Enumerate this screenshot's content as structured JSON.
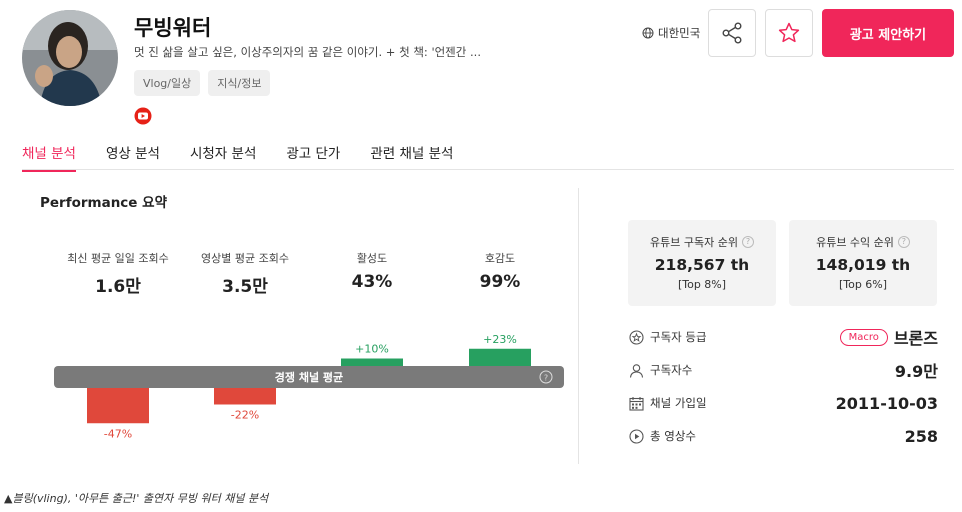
{
  "channel": {
    "name": "무빙워터",
    "description": "멋 진 삶을 살고 싶은, 이상주의자의 꿈 같은 이야기. + 첫 책: '언젠간 ...",
    "tags": [
      "Vlog/일상",
      "지식/정보"
    ],
    "platform_icon": "youtube-icon"
  },
  "header": {
    "country": "대한민국",
    "ad_button": "광고 제안하기"
  },
  "tabs": [
    "채널 분석",
    "영상 분석",
    "시청자 분석",
    "광고 단가",
    "관련 채널 분석"
  ],
  "performance": {
    "title": "Performance 요약",
    "metrics": [
      {
        "label": "최신 평균 일일 조회수",
        "value": "1.6만"
      },
      {
        "label": "영상별 평균 조회수",
        "value": "3.5만"
      },
      {
        "label": "활성도",
        "value": "43%"
      },
      {
        "label": "호감도",
        "value": "99%"
      }
    ],
    "baseline_label": "경쟁 채널 평균"
  },
  "chart_data": {
    "type": "bar",
    "categories": [
      "최신 평균 일일 조회수",
      "영상별 평균 조회수",
      "활성도",
      "호감도"
    ],
    "values": [
      -47,
      -22,
      10,
      23
    ],
    "labels": [
      "-47%",
      "-22%",
      "+10%",
      "+23%"
    ],
    "baseline": 0,
    "colors": {
      "negative": "#e0483b",
      "positive": "#27a060",
      "baseline": "#7a7a7a"
    }
  },
  "ranks": [
    {
      "label": "유튜브 구독자 순위",
      "value": "218,567 th",
      "percent": "[Top 8%]"
    },
    {
      "label": "유튜브 수익 순위",
      "value": "148,019 th",
      "percent": "[Top 6%]"
    }
  ],
  "stats": [
    {
      "label": "구독자 등급",
      "badge": "Macro",
      "value": "브론즈",
      "icon": "medal-icon"
    },
    {
      "label": "구독자수",
      "value": "9.9만",
      "icon": "person-icon"
    },
    {
      "label": "채널 가입일",
      "value": "2011-10-03",
      "icon": "calendar-icon"
    },
    {
      "label": "총 영상수",
      "value": "258",
      "icon": "play-icon"
    }
  ],
  "caption": "▲블링(vling), '아무튼 출근!' 출연자 무빙 워터 채널 분석",
  "colors": {
    "accent": "#f0265a"
  }
}
